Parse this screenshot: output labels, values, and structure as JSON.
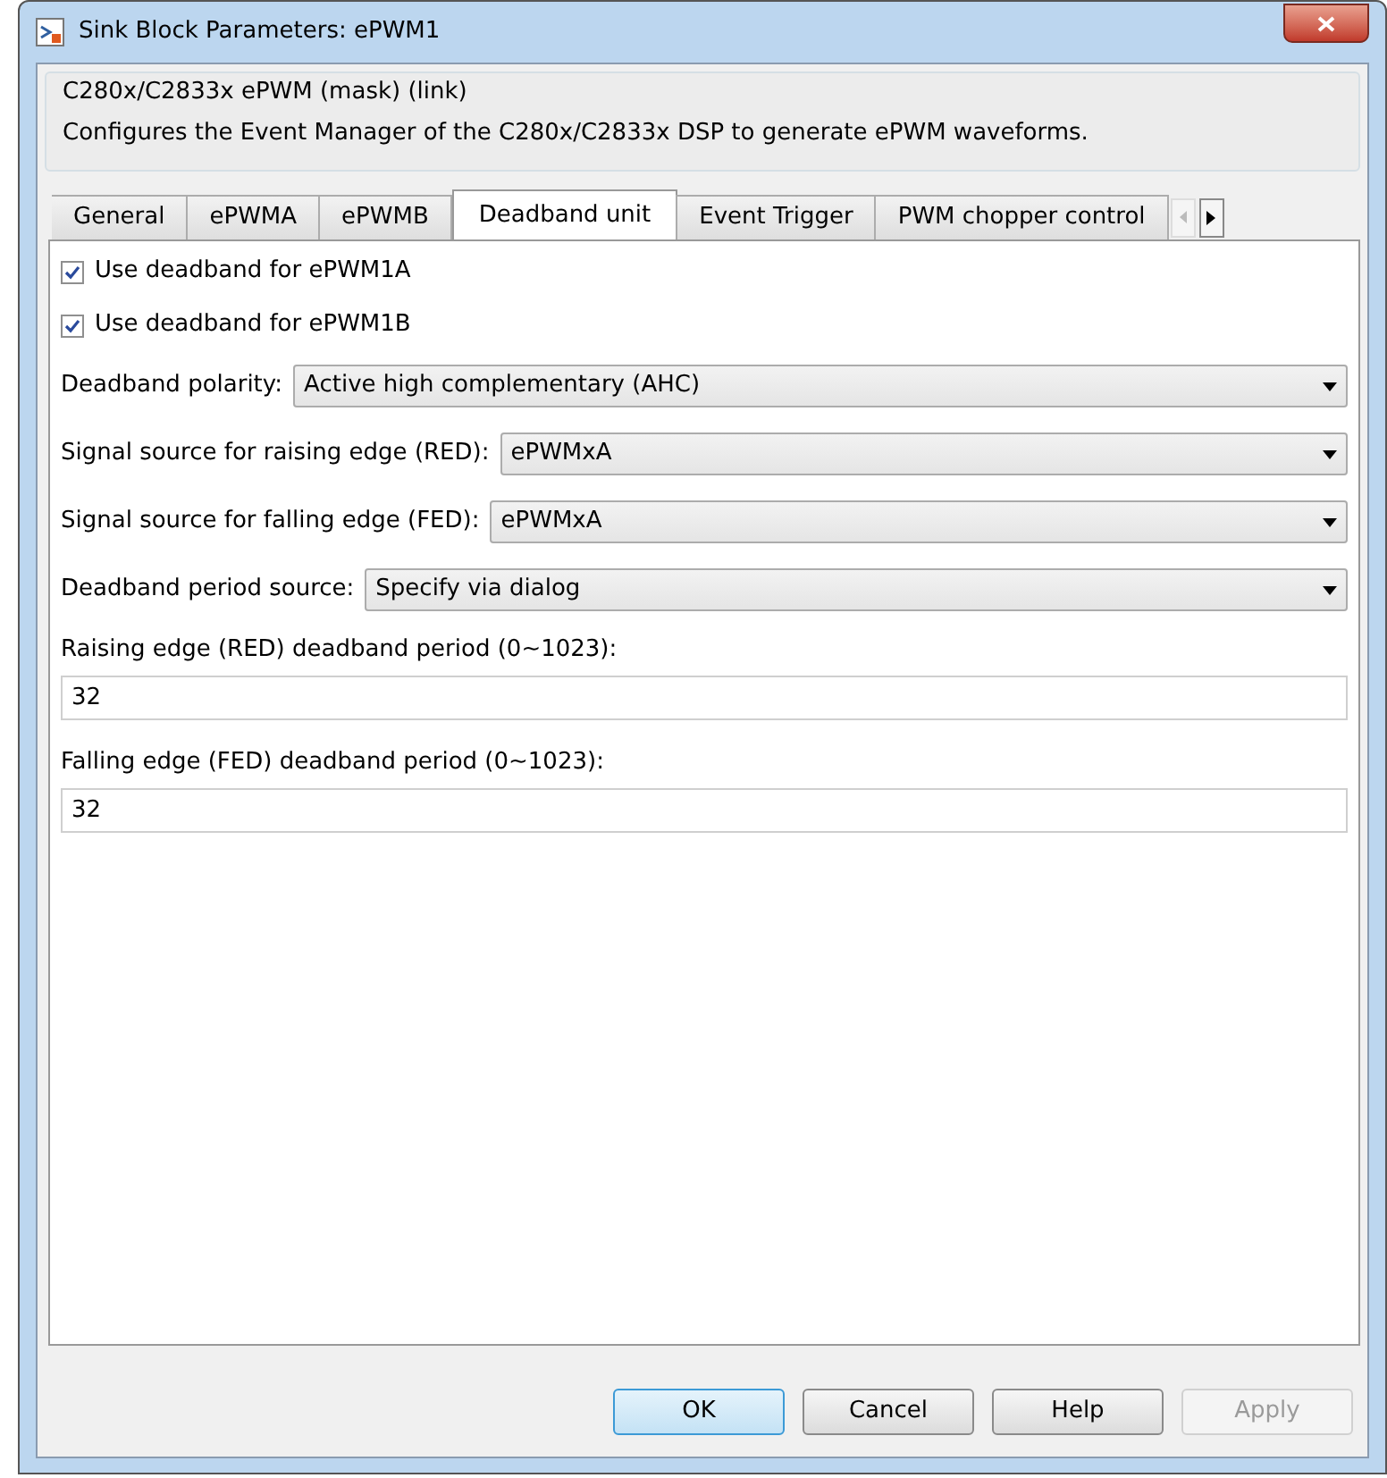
{
  "window": {
    "title": "Sink Block Parameters: ePWM1"
  },
  "mask": {
    "title": "C280x/C2833x ePWM (mask) (link)",
    "description": "Configures the Event Manager of the C280x/C2833x DSP to generate ePWM waveforms."
  },
  "tabs": [
    {
      "label": "General",
      "selected": false
    },
    {
      "label": "ePWMA",
      "selected": false
    },
    {
      "label": "ePWMB",
      "selected": false
    },
    {
      "label": "Deadband unit",
      "selected": true
    },
    {
      "label": "Event Trigger",
      "selected": false
    },
    {
      "label": "PWM chopper control",
      "selected": false
    }
  ],
  "parameters": [
    {
      "kind": "checkbox",
      "label": "Use deadband for ePWM1A",
      "checked": true
    },
    {
      "kind": "checkbox",
      "label": "Use deadband for ePWM1B",
      "checked": true
    },
    {
      "kind": "dropdown",
      "label": "Deadband polarity:",
      "value": "Active high complementary (AHC)"
    },
    {
      "kind": "dropdown",
      "label": "Signal source for raising edge (RED):",
      "value": "ePWMxA"
    },
    {
      "kind": "dropdown",
      "label": "Signal source for falling edge (FED):",
      "value": "ePWMxA"
    },
    {
      "kind": "dropdown",
      "label": "Deadband period source:",
      "value": "Specify via dialog"
    },
    {
      "kind": "text",
      "label": "Raising edge (RED) deadband period (0~1023):",
      "value": "32"
    },
    {
      "kind": "text",
      "label": "Falling edge (FED) deadband period (0~1023):",
      "value": "32"
    }
  ],
  "buttons": [
    {
      "label": "OK",
      "default": true,
      "disabled": false
    },
    {
      "label": "Cancel",
      "default": false,
      "disabled": false
    },
    {
      "label": "Help",
      "default": false,
      "disabled": false
    },
    {
      "label": "Apply",
      "default": false,
      "disabled": true
    }
  ]
}
